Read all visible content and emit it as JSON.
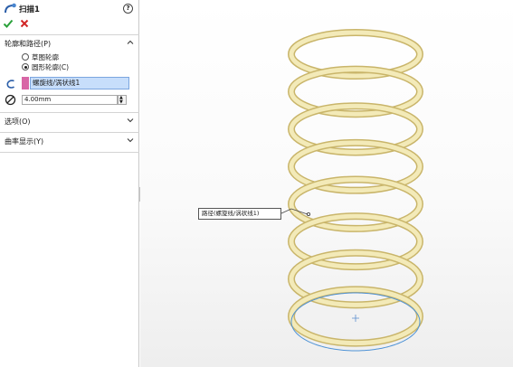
{
  "panel": {
    "title": "扫描1",
    "help": "?",
    "ok_symbol": "✔",
    "cancel_symbol": "✕"
  },
  "sections": {
    "profile_path": {
      "label": "轮廓和路径(P)",
      "options": [
        {
          "label": "草图轮廓",
          "checked": false
        },
        {
          "label": "圆形轮廓(C)",
          "checked": true
        }
      ],
      "path_value": "螺旋线/涡状线1",
      "diameter_value": "4.00mm"
    },
    "options": {
      "label": "选项(O)"
    },
    "curvature": {
      "label": "曲率显示(Y)"
    }
  },
  "viewport": {
    "callout_text": "路径(螺旋线/涡状线1)"
  },
  "colors": {
    "spring_fill": "#f3eab8",
    "spring_edge": "#c9b56a",
    "path_line": "#4f93d6",
    "accept_green": "#2aa13a",
    "cancel_red": "#d12626",
    "selection_bg": "#c7defb",
    "swatch_pink": "#d866a6"
  }
}
